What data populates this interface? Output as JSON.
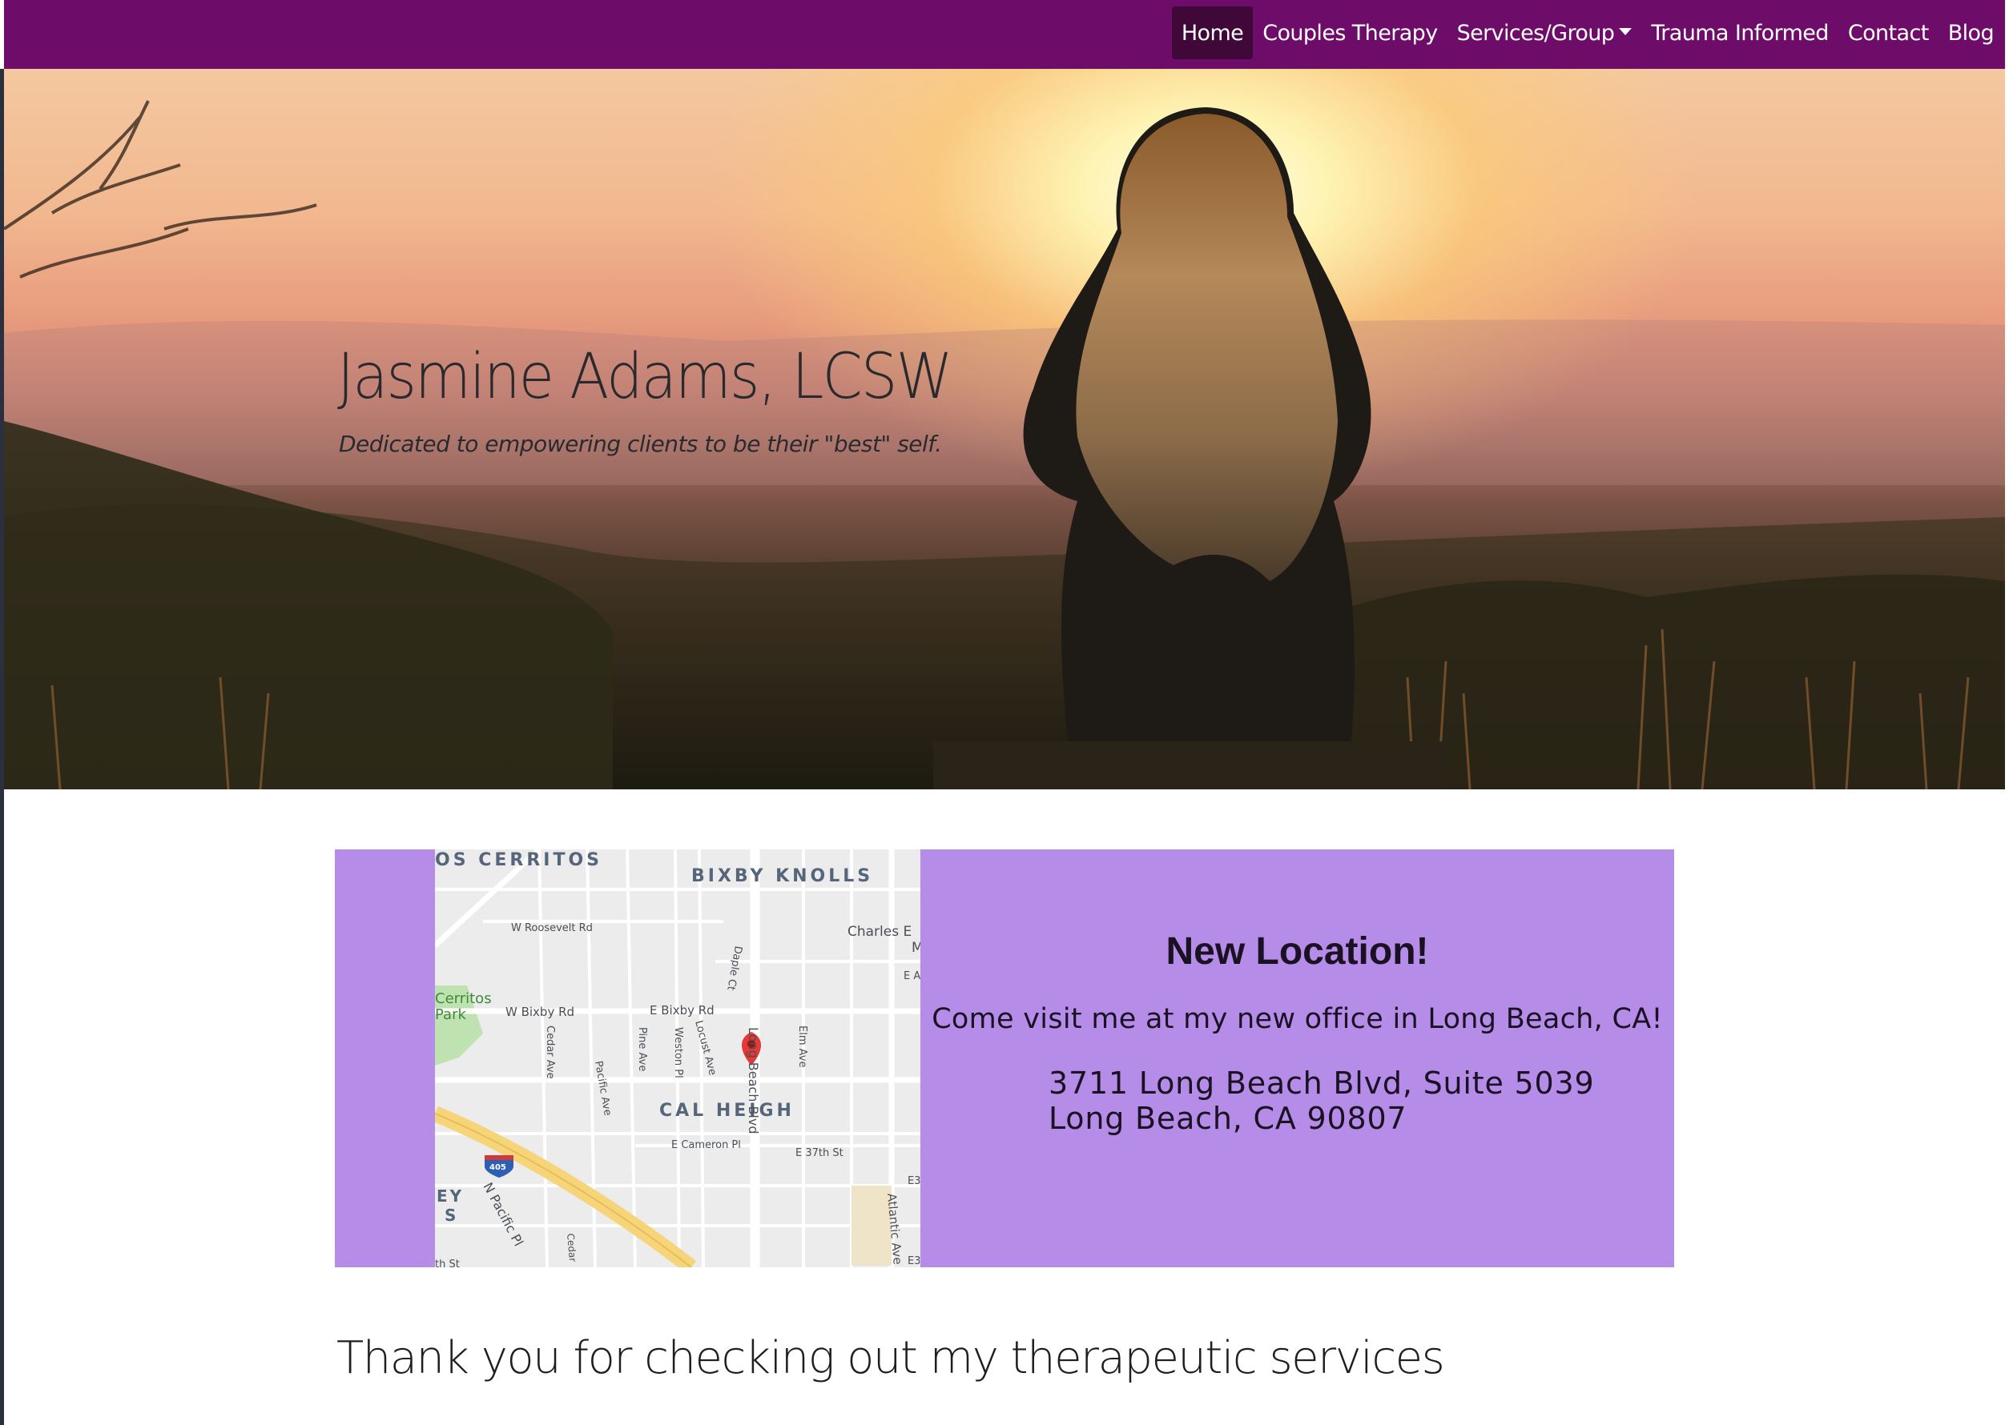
{
  "nav": {
    "items": [
      {
        "label": "Home",
        "active": true
      },
      {
        "label": "Couples Therapy",
        "active": false
      },
      {
        "label": "Services/Group",
        "active": false,
        "dropdown": true
      },
      {
        "label": "Trauma Informed",
        "active": false
      },
      {
        "label": "Contact",
        "active": false
      },
      {
        "label": "Blog",
        "active": false
      }
    ]
  },
  "hero": {
    "title": "Jasmine Adams, LCSW",
    "subtitle": "Dedicated to empowering clients to be their \"best\" self."
  },
  "location": {
    "heading": "New Location!",
    "description": "Come visit me at my new office in Long Beach, CA!",
    "address_line1": "3711 Long Beach Blvd, Suite 5039",
    "address_line2": "Long Beach, CA 90807",
    "map_labels": {
      "los_cerritos": "OS CERRITOS",
      "bixby_knolls": "BIXBY KNOLLS",
      "roosevelt": "W Roosevelt Rd",
      "charles": "Charles E",
      "charles2": "M",
      "cerritos_park1": "Cerritos",
      "cerritos_park2": "Park",
      "w_bixby": "W Bixby Rd",
      "e_bixby": "E Bixby Rd",
      "cedar": "Cedar Ave",
      "pacific": "Pacific Ave",
      "pine": "Pine Ave",
      "weston": "Weston Pl",
      "locust": "Locust Ave",
      "long_beach_blvd": "Long Beach Blvd",
      "elm": "Elm Ave",
      "e37": "E 37th St",
      "cameron": "E Cameron Pl",
      "cal_heights": "CAL HEIGH",
      "i405": "405",
      "n_pacific": "N Pacific Pl",
      "atlantic": "Atlantic Ave",
      "ea": "E A",
      "e3a": "E3",
      "e3b": "E3",
      "dapple": "Daple Ct",
      "ey": "EY",
      "s": "S",
      "th_st": "th St",
      "cedar2": "Cedar"
    }
  },
  "thanks": "Thank you for checking out my therapeutic services",
  "colors": {
    "navbar": "#6e0c6a",
    "nav_active": "#3f0839",
    "location_bg": "#b58ce8",
    "map_pin": "#e53935"
  }
}
